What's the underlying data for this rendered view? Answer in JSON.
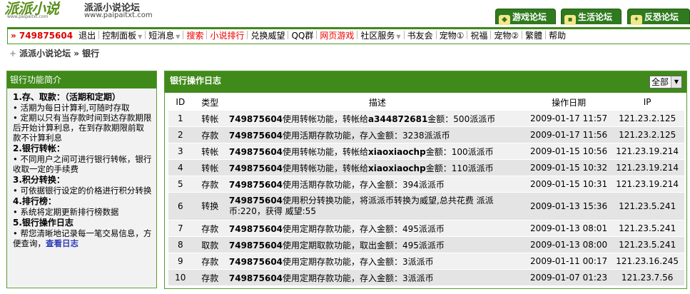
{
  "header": {
    "logo_text": "派派小说",
    "logo_url": "www.paipaitxt.com",
    "site_title": "派派小说论坛",
    "site_url": "www.paipaitxt.com",
    "forum_tabs": [
      "游戏论坛",
      "生活论坛",
      "反恐论坛"
    ]
  },
  "nav": {
    "user": "» 749875604",
    "items": [
      {
        "label": "退出"
      },
      {
        "label": "控制面板",
        "dropdown": true
      },
      {
        "label": "短消息",
        "dropdown": true
      },
      {
        "label": "搜索",
        "color": "red"
      },
      {
        "label": "小说排行",
        "color": "red"
      },
      {
        "label": "兑换威望"
      },
      {
        "label": "QQ群"
      },
      {
        "label": "网页游戏",
        "color": "red"
      },
      {
        "label": "社区服务",
        "dropdown": true
      },
      {
        "label": "书友会"
      },
      {
        "label": "宠物①"
      },
      {
        "label": "祝福"
      },
      {
        "label": "宠物②"
      },
      {
        "label": "繁體"
      },
      {
        "label": "帮助"
      }
    ]
  },
  "breadcrumb": {
    "icon": "+",
    "text": "派派小说论坛 » 银行"
  },
  "left_panel": {
    "title": "银行功能简介",
    "sections": [
      {
        "title": "1.存、取款：（活期和定期）",
        "lines": [
          "•  活期为每日计算利,可随时存取",
          "•  定期以只有当存款时间到达存款期限后开始计算利息，在到存款期限前取款不计算利息"
        ]
      },
      {
        "title": "2.银行转帐：",
        "lines": [
          "•  不同用户之间可进行银行转帐，银行收取一定的手续费"
        ]
      },
      {
        "title": "3.积分转换：",
        "lines": [
          "•  可依据银行设定的价格进行积分转换"
        ]
      },
      {
        "title": "4.排行榜：",
        "lines": [
          "•  系统将定期更新排行榜数据"
        ]
      },
      {
        "title": "5.银行操作日志",
        "lines": [
          "•  帮您清晰地记录每一笔交易信息，方便查询，"
        ],
        "link": "查看日志"
      }
    ]
  },
  "log": {
    "title": "银行操作日志",
    "filter": "全部",
    "columns": [
      "ID",
      "类型",
      "描述",
      "操作日期",
      "IP"
    ],
    "rows": [
      {
        "id": "1",
        "type": "转帐",
        "user": "749875604",
        "desc": "使用转帐功能，转帐给",
        "target": "a344872681",
        "rest": "金额：500派派币",
        "date": "2009-01-17 11:57",
        "ip": "121.23.2.125"
      },
      {
        "id": "2",
        "type": "存款",
        "user": "749875604",
        "desc": "使用活期存款功能，存入金额：3238派派币",
        "target": "",
        "rest": "",
        "date": "2009-01-17 11:56",
        "ip": "121.23.2.125"
      },
      {
        "id": "3",
        "type": "转帐",
        "user": "749875604",
        "desc": "使用转帐功能，转帐给",
        "target": "xiaoxiaochp",
        "rest": "金额：100派派币",
        "date": "2009-01-15 10:56",
        "ip": "121.23.19.214"
      },
      {
        "id": "4",
        "type": "转帐",
        "user": "749875604",
        "desc": "使用转帐功能，转帐给",
        "target": "xiaoxiaochp",
        "rest": "金额：110派派币",
        "date": "2009-01-15 10:32",
        "ip": "121.23.19.214"
      },
      {
        "id": "5",
        "type": "存款",
        "user": "749875604",
        "desc": "使用活期存款功能，存入金额：394派派币",
        "target": "",
        "rest": "",
        "date": "2009-01-15 10:31",
        "ip": "121.23.19.214"
      },
      {
        "id": "6",
        "type": "转换",
        "user": "749875604",
        "desc": "使用积分转换功能，将派派币转换为威望,总共花费 派派币:220，获得 威望:55",
        "target": "",
        "rest": "",
        "date": "2009-01-13 15:36",
        "ip": "121.23.5.241"
      },
      {
        "id": "7",
        "type": "存款",
        "user": "749875604",
        "desc": "使用定期存款功能，存入金额：495派派币",
        "target": "",
        "rest": "",
        "date": "2009-01-13 08:01",
        "ip": "121.23.5.241"
      },
      {
        "id": "8",
        "type": "取款",
        "user": "749875604",
        "desc": "使用定期取款功能，取出金额：495派派币",
        "target": "",
        "rest": "",
        "date": "2009-01-13 08:00",
        "ip": "121.23.5.241"
      },
      {
        "id": "9",
        "type": "存款",
        "user": "749875604",
        "desc": "使用定期存款功能，存入金额：3派派币",
        "target": "",
        "rest": "",
        "date": "2009-01-11 00:17",
        "ip": "121.23.16.245"
      },
      {
        "id": "10",
        "type": "存款",
        "user": "749875604",
        "desc": "使用定期存款功能，存入金额：3派派币",
        "target": "",
        "rest": "",
        "date": "2009-01-07 01:23",
        "ip": "121.23.7.56"
      }
    ]
  },
  "colors": {
    "green": "#3f8a1a",
    "link": "#2b3bb5",
    "red": "#e00000"
  }
}
